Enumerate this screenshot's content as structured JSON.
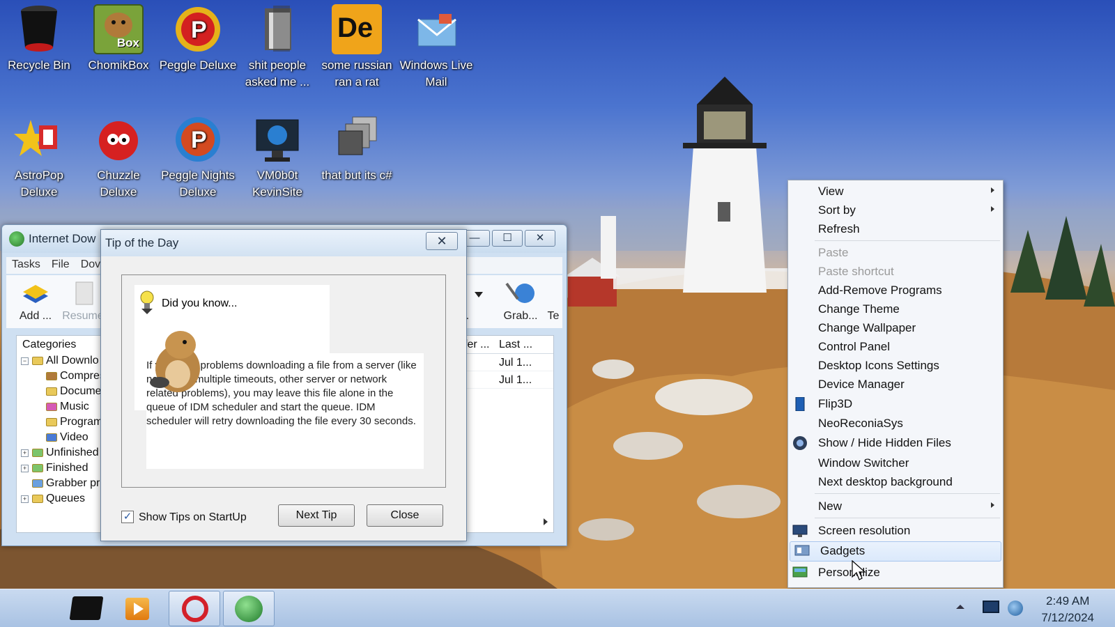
{
  "desktop": {
    "icons": [
      {
        "label": "Recycle Bin"
      },
      {
        "label": "ChomikBox",
        "badge": "Box"
      },
      {
        "label": "Peggle Deluxe"
      },
      {
        "label": "shit people asked me ..."
      },
      {
        "label": "some russian ran a rat",
        "badge": "De"
      },
      {
        "label": "Windows Live Mail"
      },
      {
        "label": "AstroPop Deluxe"
      },
      {
        "label": "Chuzzle Deluxe"
      },
      {
        "label": "Peggle Nights Deluxe"
      },
      {
        "label": "VM0b0t KevinSite"
      },
      {
        "label": "that but its c#"
      }
    ]
  },
  "idm": {
    "title": "Internet Dow",
    "min_label": "—",
    "max_label": "☐",
    "close_label": "✕",
    "menu": [
      "Tasks",
      "File",
      "Dov"
    ],
    "toolbar": {
      "add": "Add ...",
      "resume": "Resume",
      "partial": "b...",
      "grab": "Grab...",
      "te": "Te"
    },
    "categories_header": "Categories",
    "tree": [
      "All Downlo",
      "Compres",
      "Documen",
      "Music",
      "Program",
      "Video",
      "Unfinished",
      "Finished",
      "Grabber pr",
      "Queues"
    ],
    "list_headers": [
      "sfer ...",
      "Last ..."
    ],
    "list_rows": [
      "Jul 1...",
      "Jul 1..."
    ]
  },
  "tip_dialog": {
    "title": "Tip of the Day",
    "close_label": "✕",
    "heading": "Did you know...",
    "text": "If you have problems downloading a file from a server (like no server, multiple timeouts, other server or network related problems), you may leave this file alone in the queue of IDM scheduler and start the queue. IDM scheduler will retry downloading the file every 30 seconds.",
    "show_tips_label": "Show Tips on StartUp",
    "show_tips_checked": true,
    "check_mark": "✓",
    "next_tip_label": "Next Tip",
    "close_button_label": "Close"
  },
  "context_menu": {
    "items": [
      {
        "label": "View",
        "submenu": true
      },
      {
        "label": "Sort by",
        "submenu": true
      },
      {
        "label": "Refresh"
      },
      {
        "label": "Paste",
        "disabled": true
      },
      {
        "label": "Paste shortcut",
        "disabled": true
      },
      {
        "label": "Add-Remove Programs"
      },
      {
        "label": "Change Theme"
      },
      {
        "label": "Change Wallpaper"
      },
      {
        "label": "Control Panel"
      },
      {
        "label": "Desktop Icons Settings"
      },
      {
        "label": "Device Manager"
      },
      {
        "label": "Flip3D"
      },
      {
        "label": "NeoReconiaSys"
      },
      {
        "label": "Show / Hide Hidden Files"
      },
      {
        "label": "Window Switcher"
      },
      {
        "label": "Next desktop background"
      },
      {
        "label": "New",
        "submenu": true
      },
      {
        "label": "Screen resolution"
      },
      {
        "label": "Gadgets",
        "highlighted": true
      },
      {
        "label": "Personalize"
      }
    ]
  },
  "taskbar": {
    "time": "2:49 AM",
    "date": "7/12/2024"
  },
  "colors": {
    "menu_bg": "#f4f6fa",
    "highlight": "#dbe9fb",
    "taskbar": "#b9cfea",
    "sky": "#3a63c4"
  }
}
